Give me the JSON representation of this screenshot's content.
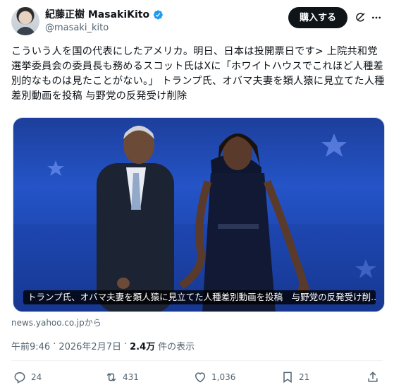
{
  "author": {
    "display_name": "紀藤正樹 MasakiKito",
    "handle": "@masaki_kito",
    "verified": true
  },
  "header": {
    "subscribe_label": "購入する"
  },
  "tweet": {
    "text": "こういう人を国の代表にしたアメリカ。明日、日本は投開票日です> 上院共和党選挙委員会の委員長も務めるスコット氏はXに「ホワイトハウスでこれほど人種差別的なものは見たことがない。」 トランプ氏、オバマ夫妻を類人猿に見立てた人種差別動画を投稿 与野党の反発受け削除"
  },
  "media": {
    "caption": "トランプ氏、オバマ夫妻を類人猿に見立てた人種差別動画を投稿　与野党の反発受け削..."
  },
  "link_source": "news.yahoo.co.jpから",
  "meta": {
    "time": "午前9:46",
    "date": "2026年2月7日",
    "separator": "·",
    "views_count": "2.4万",
    "views_label": "件の表示"
  },
  "actions": {
    "replies": "24",
    "reposts": "431",
    "likes": "1,036",
    "bookmarks": "21"
  },
  "colors": {
    "text": "#0f1419",
    "secondary": "#536471",
    "verified": "#1d9bf0",
    "button_bg": "#0f1419"
  }
}
